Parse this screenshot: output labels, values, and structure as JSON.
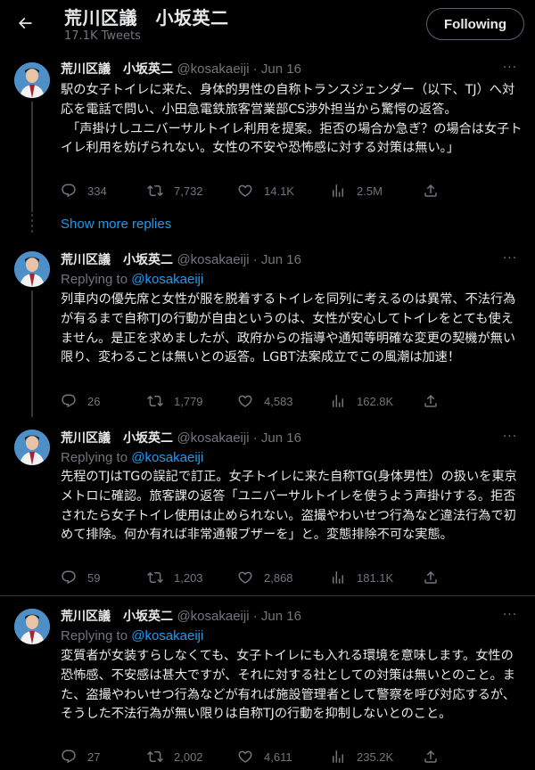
{
  "header": {
    "name": "荒川区議　小坂英二",
    "tweet_count": "17.1K Tweets",
    "follow_label": "Following"
  },
  "show_more_replies": "Show more replies",
  "tweets": [
    {
      "name": "荒川区議　小坂英二",
      "handle_date": "@kosakaeiji · Jun 16",
      "replying_prefix": "",
      "replying_to": "",
      "text": "駅の女子トイレに来た、身体的男性の自称トランスジェンダー（以下、TJ）へ対応を電話で問い、小田急電鉄旅客営業部CS渉外担当から驚愕の返答。\n　「声掛けしユニバーサルトイレ利用を提案。拒否の場合か急ぎ？の場合は女子トイレ利用を妨げられない。女性の不安や恐怖感に対する対策は無い。」",
      "replies": "334",
      "retweets": "7,732",
      "likes": "14.1K",
      "views": "2.5M"
    },
    {
      "name": "荒川区議　小坂英二",
      "handle_date": "@kosakaeiji · Jun 16",
      "replying_prefix": "Replying to ",
      "replying_to": "@kosakaeiji",
      "text": "列車内の優先席と女性が服を脱着するトイレを同列に考えるのは異常、不法行為が有るまで自称TJの行動が自由というのは、女性が安心してトイレをとても使えません。是正を求めましたが、政府からの指導や通知等明確な変更の契機が無い限り、変わることは無いとの返答。LGBT法案成立でこの風潮は加速！",
      "replies": "26",
      "retweets": "1,779",
      "likes": "4,583",
      "views": "162.8K"
    },
    {
      "name": "荒川区議　小坂英二",
      "handle_date": "@kosakaeiji · Jun 16",
      "replying_prefix": "Replying to ",
      "replying_to": "@kosakaeiji",
      "text": "先程のTJはTGの誤記で訂正。女子トイレに来た自称TG(身体男性）の扱いを東京メトロに確認。旅客課の返答「ユニバーサルトイレを使うよう声掛けする。拒否されたら女子トイレ使用は止められない。盗撮やわいせつ行為など違法行為で初めて排除。何か有れば非常通報ブザーを」と。変態排除不可な実態。",
      "replies": "59",
      "retweets": "1,203",
      "likes": "2,868",
      "views": "181.1K"
    },
    {
      "name": "荒川区議　小坂英二",
      "handle_date": "@kosakaeiji · Jun 16",
      "replying_prefix": "Replying to ",
      "replying_to": "@kosakaeiji",
      "text": "変質者が女装すらしなくても、女子トイレにも入れる環境を意味します。女性の恐怖感、不安感は甚大ですが、それに対する社としての対策は無いとのこと。また、盗撮やわいせつ行為などが有れば施設管理者として警察を呼び対応するが、そうした不法行為が無い限りは自称TJの行動を抑制しないとのこと。",
      "replies": "27",
      "retweets": "2,002",
      "likes": "4,611",
      "views": "235.2K"
    }
  ],
  "icons": {
    "back": "arrow-left-icon",
    "more": "more-dots-icon",
    "reply": "reply-bubble-icon",
    "retweet": "retweet-icon",
    "like": "heart-icon",
    "views": "views-bars-icon",
    "share": "share-icon"
  },
  "colors": {
    "background": "#000000",
    "text": "#e7e9ea",
    "muted": "#71767b",
    "link": "#1d9bf0",
    "border": "#2f3336"
  }
}
